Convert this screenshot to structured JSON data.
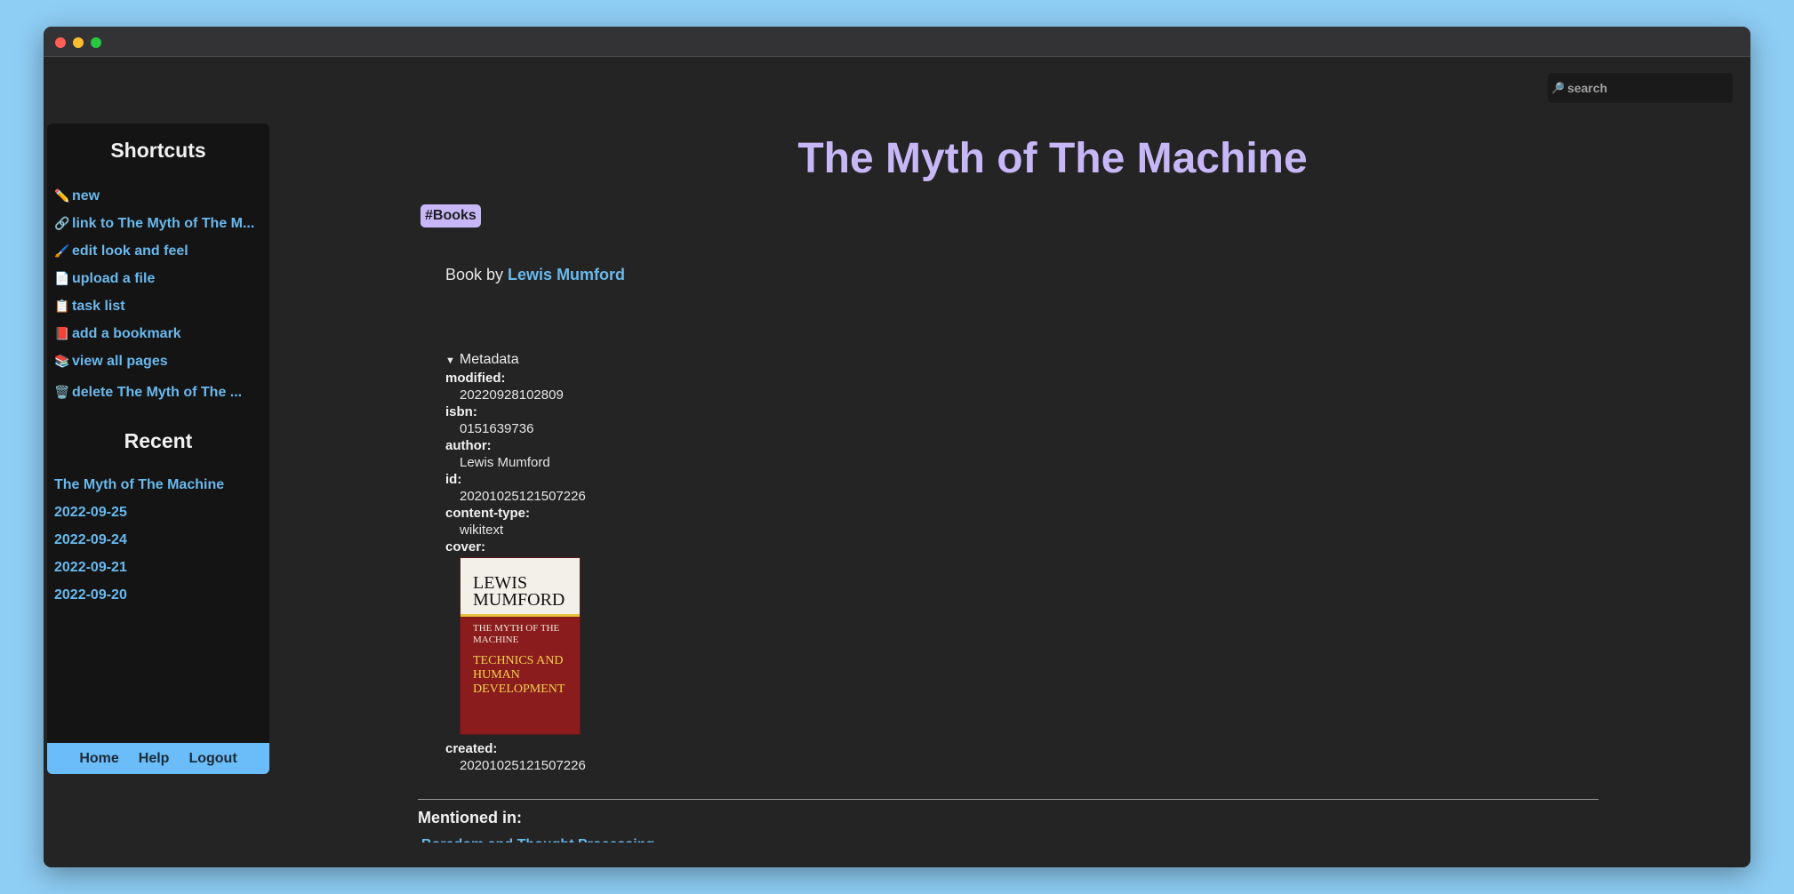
{
  "search": {
    "placeholder": "search",
    "icon": "magnifier-icon"
  },
  "sidebar": {
    "shortcuts_title": "Shortcuts",
    "shortcuts": [
      {
        "icon": "✏️",
        "label": "new"
      },
      {
        "icon": "🔗",
        "label": "link to The Myth of The M..."
      },
      {
        "icon": "🖌️",
        "label": "edit look and feel"
      },
      {
        "icon": "📄",
        "label": "upload a file"
      },
      {
        "icon": "📋",
        "label": "task list"
      },
      {
        "icon": "📕",
        "label": "add a bookmark"
      },
      {
        "icon": "📚",
        "label": "view all pages"
      },
      {
        "icon": "🗑️",
        "label": "delete The Myth of The ..."
      }
    ],
    "recent_title": "Recent",
    "recent": [
      "The Myth of The Machine",
      "2022-09-25",
      "2022-09-24",
      "2022-09-21",
      "2022-09-20"
    ],
    "footer": {
      "home": "Home",
      "help": "Help",
      "logout": "Logout"
    }
  },
  "page": {
    "title": "The Myth of The Machine",
    "tag": "#Books",
    "intro_prefix": "Book by ",
    "intro_link": "Lewis Mumford",
    "metadata_summary": "Metadata",
    "metadata": {
      "modified_label": "modified:",
      "modified": "20220928102809",
      "isbn_label": "isbn:",
      "isbn": "0151639736",
      "author_label": "author:",
      "author": "Lewis Mumford",
      "id_label": "id:",
      "id": "20201025121507226",
      "content_type_label": "content-type:",
      "content_type": "wikitext",
      "cover_label": "cover:",
      "created_label": "created:",
      "created": "20201025121507226"
    },
    "cover": {
      "author_line1": "LEWIS",
      "author_line2": "MUMFORD",
      "subtitle_line1": "THE MYTH OF THE",
      "subtitle_line2": "MACHINE",
      "main_line1": "TECHNICS AND",
      "main_line2": "HUMAN",
      "main_line3": "DEVELOPMENT"
    },
    "mentioned_title": "Mentioned in:",
    "mentioned": [
      "Boredom and Thought Processing"
    ]
  },
  "colors": {
    "accent_purple": "#c7b7f7",
    "link_blue": "#6ab8ec",
    "footer_blue": "#6abdf8",
    "background": "#242424"
  }
}
